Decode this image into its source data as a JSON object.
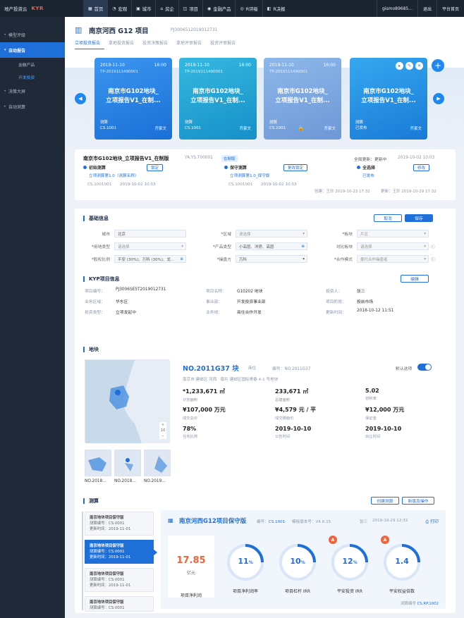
{
  "topbar": {
    "brand_title": "地产投资云",
    "brand_logo": "KYR",
    "nav": [
      {
        "icon": "▦",
        "label": "首页"
      },
      {
        "icon": "◔",
        "label": "宏观"
      },
      {
        "icon": "▣",
        "label": "城市"
      },
      {
        "icon": "⌂",
        "label": "房企"
      },
      {
        "icon": "◫",
        "label": "项目"
      },
      {
        "icon": "◉",
        "label": "金融产品"
      },
      {
        "icon": "◎",
        "label": "R评级"
      },
      {
        "icon": "◧",
        "label": "R决报"
      }
    ],
    "user": "gismo89685...",
    "logout": "退出",
    "platform": "平台首页"
  },
  "sidebar": {
    "items": [
      {
        "label": "模型评级"
      },
      {
        "label": "自动报告"
      }
    ],
    "subs": [
      {
        "label": "金融产品"
      },
      {
        "label": "开发投资"
      }
    ],
    "items2": [
      {
        "label": "决策大屏"
      },
      {
        "label": "自动测算"
      }
    ]
  },
  "header": {
    "title": "南京河西 G12 项目",
    "code": "PJ3006512019012731",
    "tabs": [
      "立项投资报告",
      "拿地投资报告",
      "投资决策报告",
      "拿地评审报告",
      "投资评审报告"
    ]
  },
  "cards": [
    {
      "date": "2019-11-10",
      "time": "16:00",
      "code": "TP-2019111490001",
      "name1": "南京市G102地块_",
      "name2": "立项报告V1_在制...",
      "foot1": "测算",
      "foot2": "CS.1001",
      "author": "齐家文"
    },
    {
      "date": "2019-11-10",
      "time": "16:00",
      "code": "TP-2019111490001",
      "name1": "南京市G102地块_",
      "name2": "立项报告V1_在制...",
      "foot1": "测算",
      "foot2": "CS.1001",
      "author": "齐家文"
    },
    {
      "date": "2019-11-10",
      "time": "16:00",
      "code": "TP-2019111490001",
      "name1": "南京市G102地块_",
      "name2": "立项报告V1_在制...",
      "foot1": "测算",
      "foot2": "CS.1001",
      "author": "齐家文"
    },
    {
      "name1": "南京市G102地块_",
      "name2": "立项报告V1_在制...",
      "foot1": "测算",
      "foot2": "已发布",
      "author": "齐家文"
    }
  ],
  "report": {
    "title": "南京市G102地块_立项报告V1_在制版",
    "code": "YA.YS.T00001",
    "badge": "在制版",
    "latest_label": "全局更新：更新中",
    "latest_time": "2019-10-02 10:03",
    "steps": [
      {
        "label": "初始测算",
        "link": "立项测算第1.0（测算名称）",
        "meta1": "CS.1001001",
        "meta2": "2019-10-02 10:03",
        "btn": "锁定"
      },
      {
        "label": "保守测算",
        "link": "立项测算第1.0_保守版",
        "meta1": "CS.1001001",
        "meta2": "2019-10-02 10:03",
        "btn": "更改锁定"
      },
      {
        "label": "全选择",
        "link": "已发布",
        "meta1": "",
        "meta2": "",
        "btn": "修改"
      }
    ],
    "creator": "创建：王珍  2019-10-23 17:32",
    "updater": "更新：王珍  2019-10-29 17:32"
  },
  "basic": {
    "title": "基础信息",
    "cancel": "取消",
    "save": "保存",
    "fields": [
      {
        "label": "城市",
        "value": "北京"
      },
      {
        "label": "*区域",
        "value": "请选择"
      },
      {
        "label": "*板块",
        "value": "片区"
      },
      {
        "label": "*用地类型",
        "value": "请选择"
      },
      {
        "label": "*产品类型",
        "value": "小高层、洋房、高层"
      },
      {
        "label": "对比板块",
        "value": "请选择"
      },
      {
        "label": "*股权比例",
        "value": "平安 (30%)、万科 (30%)、龙..."
      },
      {
        "label": "*操盘方",
        "value": "万科"
      },
      {
        "label": "*合作模式",
        "value": "委托合作操盘者"
      }
    ]
  },
  "kyp": {
    "title": "KYP项目信息",
    "btn": "编辑",
    "rows": [
      [
        {
          "k": "项目编号：",
          "v": "PJ3006SE5T2019012731"
        },
        {
          "k": "项目名称：",
          "v": "G10202 地块"
        },
        {
          "k": "投资人：",
          "v": "张三"
        }
      ],
      [
        {
          "k": "业务区域：",
          "v": "华东区"
        },
        {
          "k": "事业部：",
          "v": "开发投资事业部"
        },
        {
          "k": "项目阶段：",
          "v": "投前市场"
        }
      ],
      [
        {
          "k": "投资类型：",
          "v": "立项发起中"
        },
        {
          "k": "业务线：",
          "v": "商住合作开发"
        },
        {
          "k": "更新时间：",
          "v": "2018-10-12 11:51"
        }
      ]
    ]
  },
  "plot": {
    "title": "地块",
    "name": "NO.2011G37 块",
    "tag": "商住",
    "no": "编号：NO.2011G37",
    "toggle_label": "默认选项",
    "address": "南京市 建邺区 河西 · 南片 建邺区国际青春 4-1 号地块",
    "metrics": [
      {
        "v": "*1,233,671 ㎡",
        "l": "计容面积"
      },
      {
        "v": "233,671 ㎡",
        "l": "总建面积"
      },
      {
        "v": "5.02",
        "l": "容积率"
      },
      {
        "v": "¥107,000 万元",
        "l": "成交总价"
      },
      {
        "v": "¥4,579 元 / 平",
        "l": "成交楼面价"
      },
      {
        "v": "¥12,000 万元",
        "l": "保证金"
      },
      {
        "v": "78%",
        "l": "住宅比例"
      },
      {
        "v": "2019-10-10",
        "l": "公告时间"
      },
      {
        "v": "2019-10-10",
        "l": "出让时间"
      }
    ],
    "thumbs": [
      "NO.2018...",
      "NO.2018...",
      "NO.2019..."
    ],
    "zoom_in": "+",
    "zoom_level": "10",
    "zoom_out": "−"
  },
  "calc": {
    "title": "测算",
    "btn1": "创建测算",
    "btn2": "新版及操作",
    "list": [
      {
        "t": "南京地块项目保守版",
        "a": "测算编号：CS.0001",
        "b": "更新时间：2019-11-01"
      },
      {
        "t": "南京地块项目保守版",
        "a": "测算编号：CS.0001",
        "b": "更新时间：2019-11-01"
      },
      {
        "t": "南京地块项目保守版",
        "a": "测算编号：CS.0001",
        "b": "更新时间：2019-11-01"
      },
      {
        "t": "南京地块项目保守版",
        "a": "测算编号：CS.0001",
        "b": "更新时间：2019-11-01"
      }
    ],
    "detail": {
      "title": "南京河西G12项目保守版",
      "no_label": "编号：",
      "no": "CS.1001",
      "ver_label": "模板版本号：",
      "ver": "V4.6.15",
      "editor": "张三",
      "time": "2019-10-29 12:32",
      "print": "打印",
      "big_value": "17.85",
      "big_unit": "亿元",
      "big_label": "项目净利润",
      "rings": [
        {
          "v": "11",
          "u": "%",
          "l": "项目净利润率",
          "pct": 0.11,
          "badge": ""
        },
        {
          "v": "10",
          "u": "%",
          "l": "项目杠杆 IRR",
          "pct": 0.1,
          "badge": ""
        },
        {
          "v": "12",
          "u": "%",
          "l": "平安投资 IRR",
          "pct": 0.12,
          "badge": "A"
        },
        {
          "v": "1.4",
          "u": "",
          "l": "平安权益倍数",
          "pct": 0.14,
          "badge": "A"
        }
      ],
      "version_label": "测算编号",
      "version": "CS.RP.1002"
    }
  },
  "colors": {
    "accent": "#1f6fd8",
    "orange": "#e8643c",
    "sidebar": "#1f2937"
  }
}
